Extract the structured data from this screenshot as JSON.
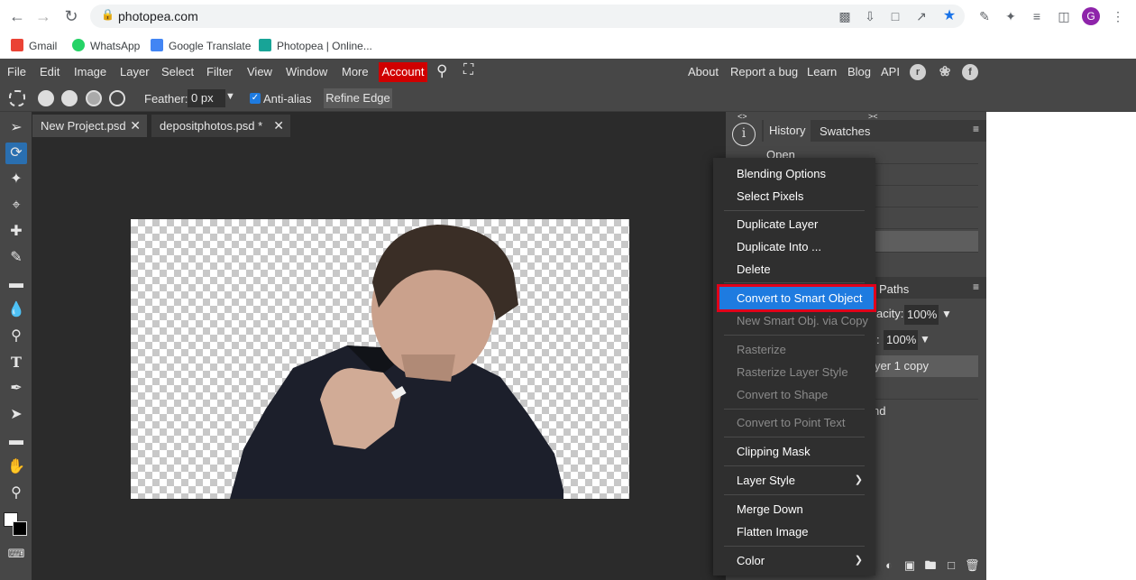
{
  "browser": {
    "url": "photopea.com",
    "avatar_letter": "G",
    "bookmarks": [
      {
        "label": "Gmail",
        "color": "#ea4335"
      },
      {
        "label": "WhatsApp",
        "color": "#25d366"
      },
      {
        "label": "Google Translate",
        "color": "#4285f4"
      },
      {
        "label": "Photopea | Online...",
        "color": "#18a497"
      }
    ]
  },
  "menu": {
    "items": [
      "File",
      "Edit",
      "Image",
      "Layer",
      "Select",
      "Filter",
      "View",
      "Window",
      "More"
    ],
    "account": "Account",
    "right_links": [
      "About",
      "Report a bug",
      "Learn",
      "Blog",
      "API"
    ]
  },
  "options": {
    "feather_label": "Feather:",
    "feather_value": "0 px",
    "antialias": "Anti-alias",
    "refine": "Refine Edge"
  },
  "tabs": [
    {
      "label": "New Project.psd"
    },
    {
      "label": "depositphotos.psd *"
    }
  ],
  "panel": {
    "tab_history": "History",
    "tab_swatches": "Swatches",
    "history_first": "Open",
    "paths_tab": "Paths",
    "opacity_label": "acity:",
    "opacity_value": "100%",
    "fill_label": ":",
    "fill_value": "100%",
    "layer_selected": "yer 1 copy",
    "layer_bg": "nd"
  },
  "context_menu": {
    "items": [
      {
        "label": "Blending Options",
        "enabled": true
      },
      {
        "label": "Select Pixels",
        "enabled": true
      },
      {
        "label": "Duplicate Layer",
        "enabled": true
      },
      {
        "label": "Duplicate Into ...",
        "enabled": true
      },
      {
        "label": "Delete",
        "enabled": true
      },
      {
        "label": "Convert to Smart Object",
        "enabled": true,
        "highlighted": true
      },
      {
        "label": "New Smart Obj. via Copy",
        "enabled": false
      },
      {
        "label": "Rasterize",
        "enabled": false
      },
      {
        "label": "Rasterize Layer Style",
        "enabled": false
      },
      {
        "label": "Convert to Shape",
        "enabled": false
      },
      {
        "label": "Convert to Point Text",
        "enabled": false
      },
      {
        "label": "Clipping Mask",
        "enabled": true
      },
      {
        "label": "Layer Style",
        "enabled": true,
        "submenu": true
      },
      {
        "label": "Merge Down",
        "enabled": true
      },
      {
        "label": "Flatten Image",
        "enabled": true
      },
      {
        "label": "Color",
        "enabled": true,
        "submenu": true
      }
    ]
  },
  "colors": {
    "accent": "#1e7be0",
    "account_bg": "#d00000",
    "highlight_border": "#e0001a"
  }
}
